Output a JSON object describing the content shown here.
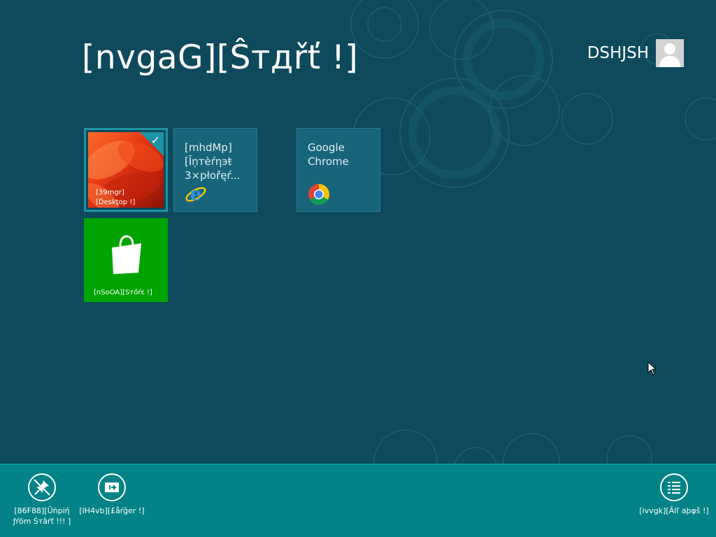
{
  "screen": {
    "title": "[nvgaG][Ŝтдřť !]",
    "user_name": "DSHJSH"
  },
  "tiles": {
    "desktop": {
      "label_line1": "[39mgr]",
      "label_line2": "[Ďeskţop !]",
      "selected": true
    },
    "ie": {
      "name": "[mhdMp][Ĩņтèŕηэŧ 3×płořęŕ..."
    },
    "chrome": {
      "name": "Google Chrome"
    },
    "store": {
      "label": "[nSoOA][Sтőŕɛ !]",
      "color": "#00a300"
    }
  },
  "appbar": {
    "unpin_label": "[86F88][Ŭńpiή ƒŕöm Śтâŕť !!! ]",
    "larger_label": "[lH4vb][£åŕğer !]",
    "all_apps_label": "[ivvgk][Ãlľ aþφš !]"
  },
  "colors": {
    "background": "#0e4a5c",
    "accent": "#038387",
    "tile": "#18657a",
    "selection": "#1b94a4"
  }
}
